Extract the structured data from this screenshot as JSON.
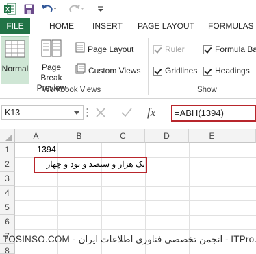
{
  "qat": {
    "app_icon": "excel-logo-icon",
    "save_icon": "save-icon",
    "undo_icon": "undo-icon",
    "redo_icon": "redo-icon",
    "customize_icon": "customize-toolbar-icon"
  },
  "tabs": {
    "file": "FILE",
    "home": "HOME",
    "insert": "INSERT",
    "page_layout": "PAGE LAYOUT",
    "formulas": "FORMULAS"
  },
  "ribbon": {
    "workbook_views": {
      "normal": "Normal",
      "page_break_line1": "Page Break",
      "page_break_line2": "Preview",
      "page_layout": "Page Layout",
      "custom_views": "Custom Views",
      "group_label": "Workbook Views"
    },
    "show": {
      "ruler": "Ruler",
      "gridlines": "Gridlines",
      "formula_bar": "Formula Ba",
      "headings": "Headings",
      "group_label": "Show"
    }
  },
  "formula_bar": {
    "name_box": "K13",
    "cancel_icon": "cancel-x-icon",
    "enter_icon": "enter-check-icon",
    "fx_label": "fx",
    "formula": "=ABH(1394)"
  },
  "grid": {
    "columns": [
      "A",
      "B",
      "C",
      "D",
      "E"
    ],
    "rows": [
      "1",
      "2",
      "3",
      "4",
      "5",
      "6",
      "7",
      "8"
    ],
    "cells": {
      "A1": "1394",
      "A2": "یک هزار و سیصد و نود و چهار"
    }
  },
  "watermark": "TOSINSO.COM - انجمن تخصصی فناوری اطلاعات ایران - ITPro.ir",
  "colors": {
    "accent": "#217346",
    "highlight_border": "#b8262c"
  }
}
